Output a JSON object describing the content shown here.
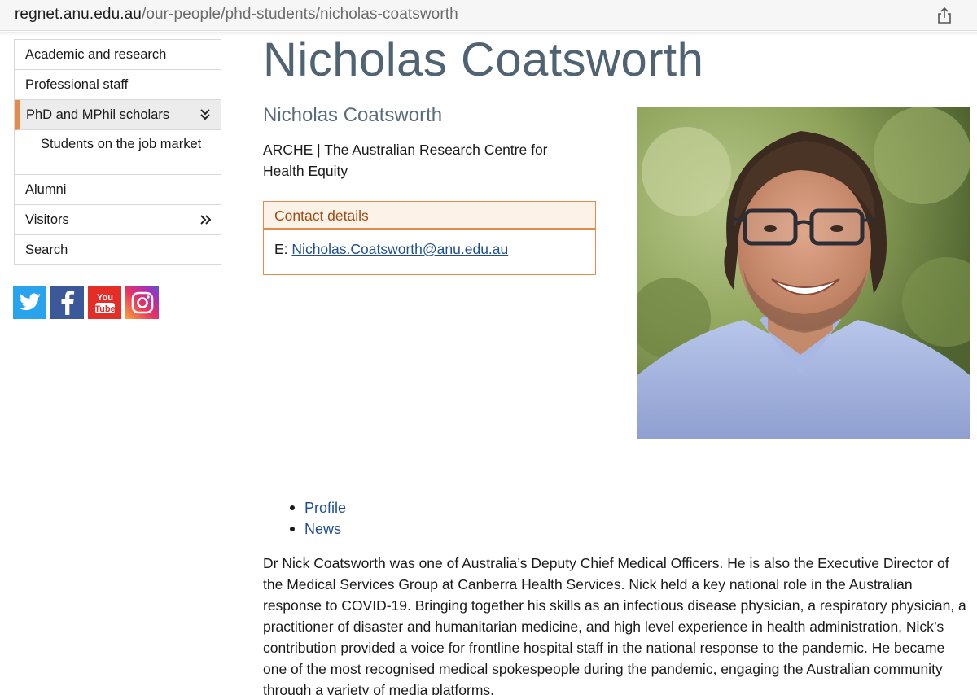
{
  "browser": {
    "url_host": "regnet.anu.edu.au",
    "url_path": "/our-people/phd-students/nicholas-coatsworth",
    "share_icon": "share-icon"
  },
  "sidebar": {
    "items": [
      {
        "label": "Academic and research"
      },
      {
        "label": "Professional staff"
      },
      {
        "label": "PhD and MPhil scholars",
        "icon": "double-chevron-down-icon"
      },
      {
        "label": "Students on the job market"
      },
      {
        "label": "Alumni"
      },
      {
        "label": "Visitors",
        "icon": "double-chevron-right-icon"
      },
      {
        "label": "Search"
      }
    ],
    "accent_color": "#e38a4c"
  },
  "social": {
    "icons": [
      "twitter-icon",
      "facebook-icon",
      "youtube-icon",
      "instagram-icon"
    ],
    "youtube_text_top": "You",
    "youtube_text_bottom": "Tube"
  },
  "profile": {
    "title": "Nicholas Coatsworth",
    "name": "Nicholas Coatsworth",
    "affiliation": "ARCHE | The Australian Research Centre for Health Equity",
    "contact_heading": "Contact details",
    "email_prefix": "E:",
    "email": "Nicholas.Coatsworth@anu.edu.au"
  },
  "tabs": [
    {
      "label": "Profile"
    },
    {
      "label": "News"
    }
  ],
  "bio": "Dr Nick Coatsworth was one of Australia’s Deputy Chief Medical Officers. He is also the Executive Director of the Medical Services Group at Canberra Health Services. Nick held a key national role in the Australian response to COVID-19. Bringing together his skills as an infectious disease physician, a respiratory physician, a practitioner of disaster and humanitarian medicine, and high level experience in health administration, Nick’s contribution provided a voice for frontline hospital staff in the national response to the pandemic. He became one of the most recognised medical spokespeople during the pandemic, engaging the Australian community through a variety of media platforms."
}
